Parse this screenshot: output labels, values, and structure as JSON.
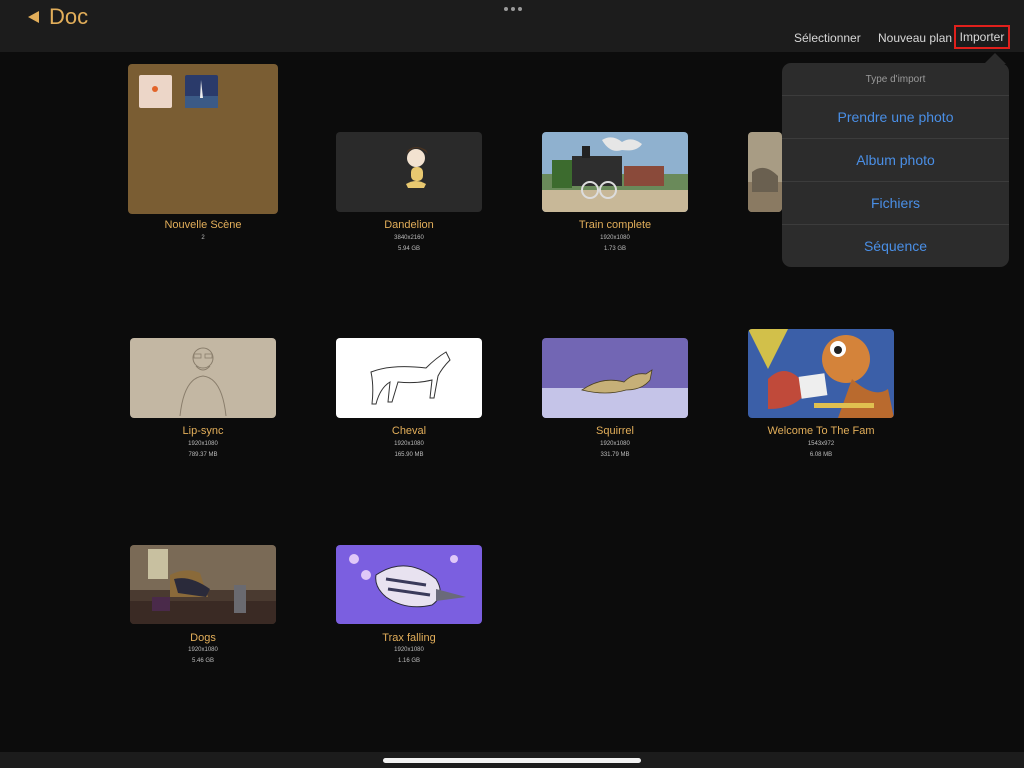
{
  "header": {
    "back_label": "Doc",
    "select_label": "Sélectionner",
    "new_plan_label": "Nouveau plan",
    "import_label": "Importer"
  },
  "import_popover": {
    "title": "Type d'import",
    "options": [
      "Prendre une photo",
      "Album photo",
      "Fichiers",
      "Séquence"
    ]
  },
  "scenes": [
    {
      "name": "Nouvelle Scène",
      "count": "2"
    },
    {
      "name": "Dandelion",
      "resolution": "3840x2160",
      "size": "5.94 GB"
    },
    {
      "name": "Train complete",
      "resolution": "1920x1080",
      "size": "1.73 GB"
    },
    {
      "name": "Lip-sync",
      "resolution": "1920x1080",
      "size": "789.37 MB"
    },
    {
      "name": "Cheval",
      "resolution": "1920x1080",
      "size": "165.90 MB"
    },
    {
      "name": "Squirrel",
      "resolution": "1920x1080",
      "size": "331.79 MB"
    },
    {
      "name": "Welcome To The Fam",
      "resolution": "1543x972",
      "size": "6.08 MB"
    },
    {
      "name": "Dogs",
      "resolution": "1920x1080",
      "size": "5.46 GB"
    },
    {
      "name": "Trax falling",
      "resolution": "1920x1080",
      "size": "1.16 GB"
    }
  ],
  "colors": {
    "accent": "#e2ae5a",
    "link": "#4a8fe6",
    "highlight": "#e0201c"
  }
}
